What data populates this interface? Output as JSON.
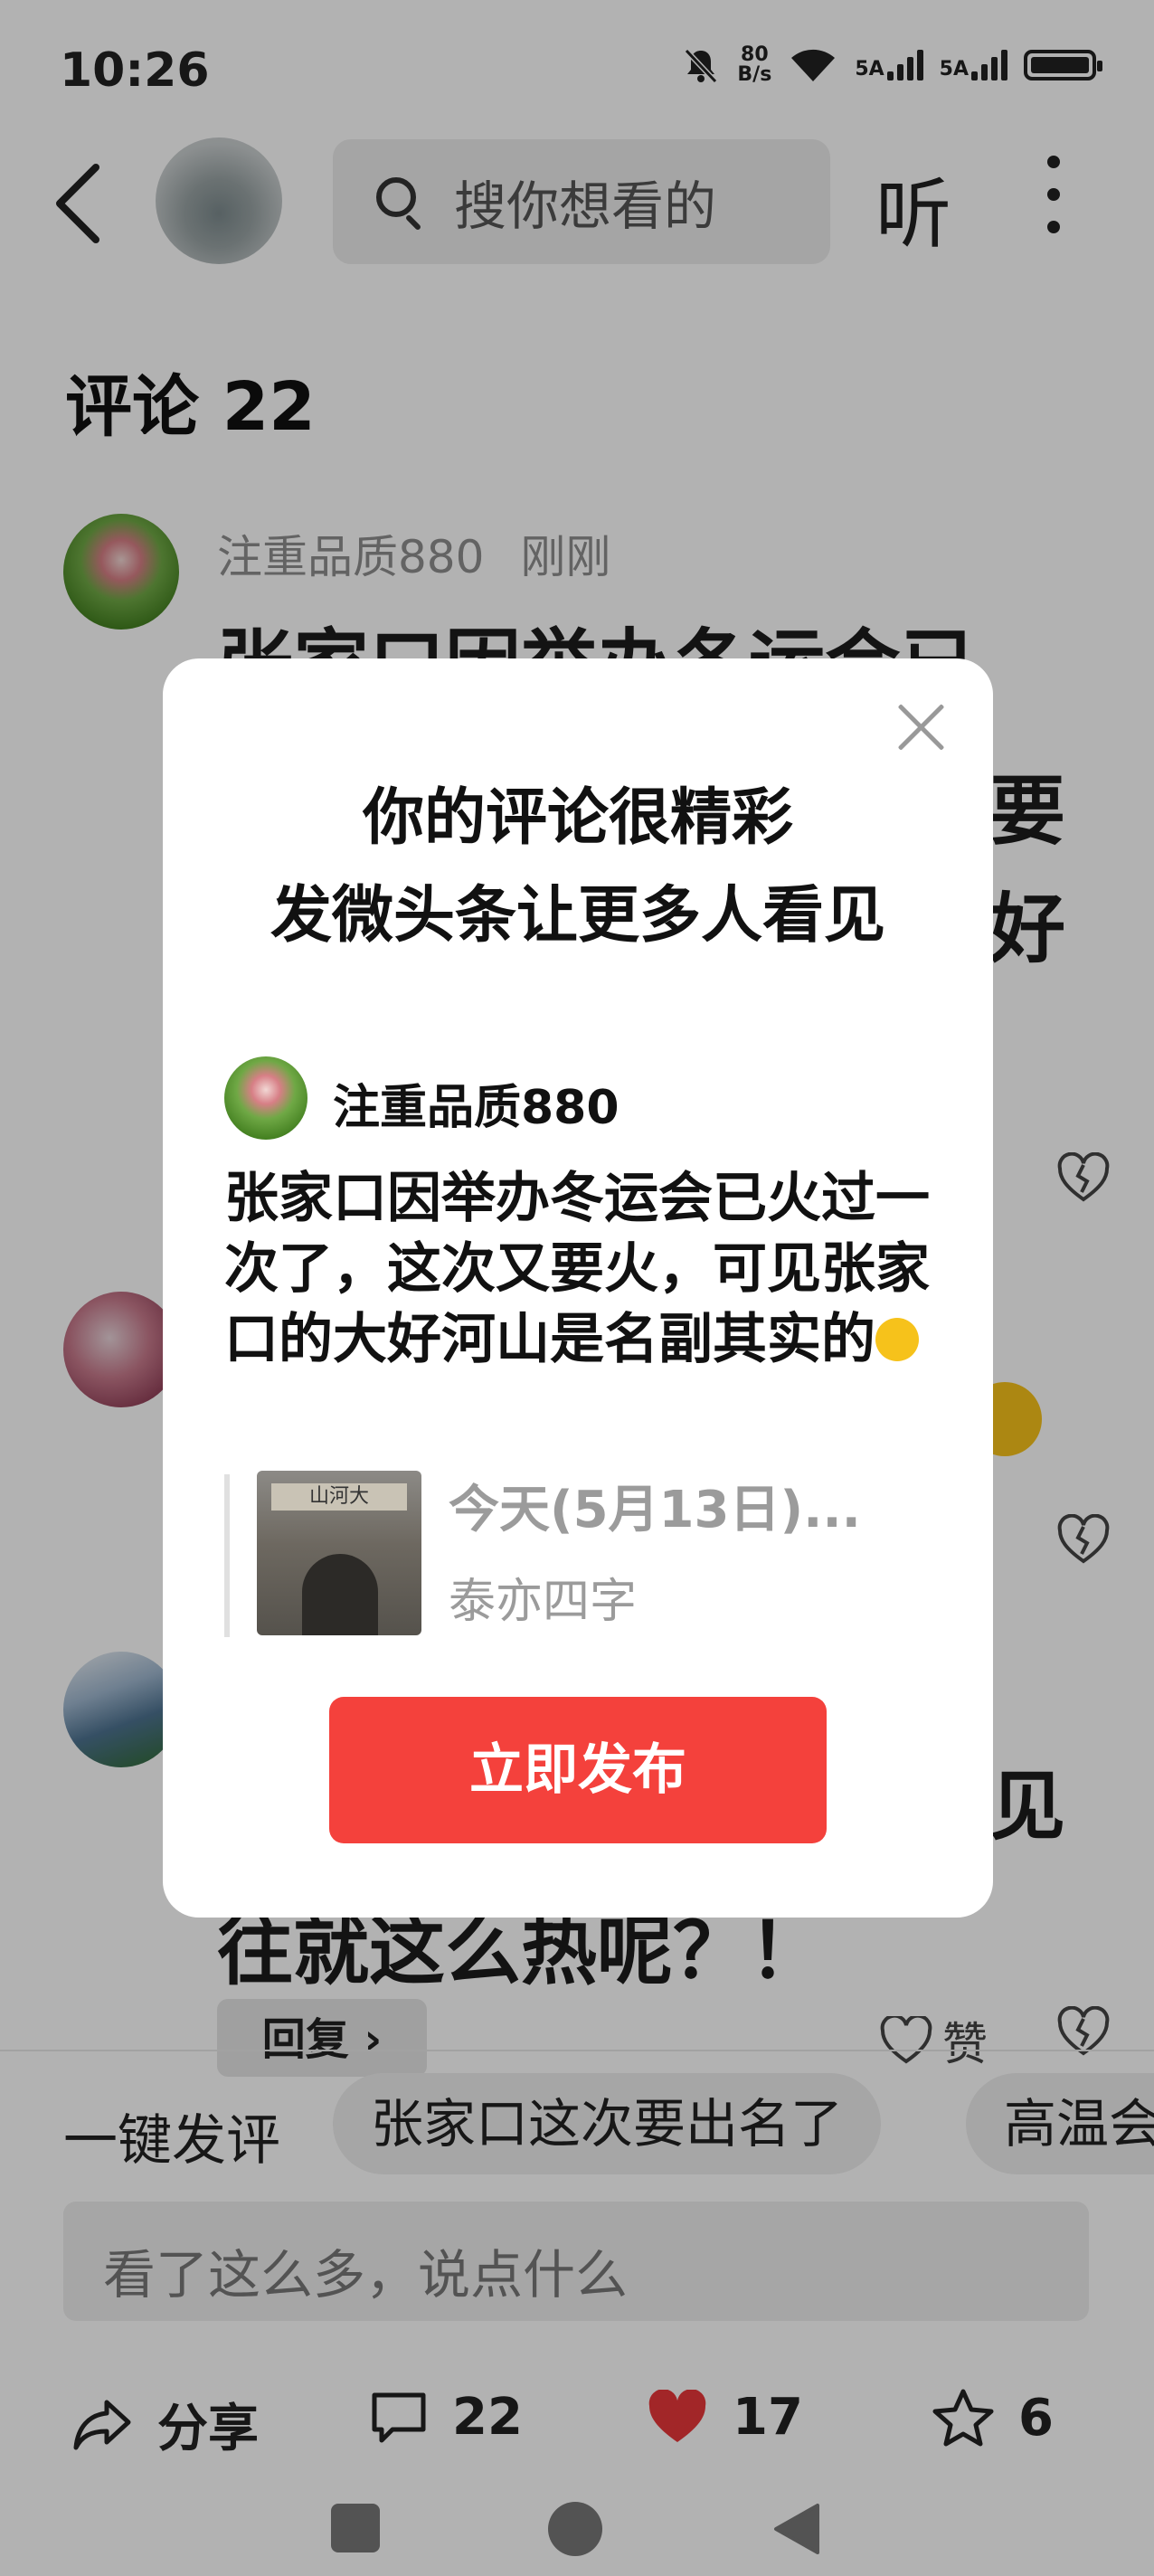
{
  "status_bar": {
    "time": "10:26",
    "net_speed_value": "80",
    "net_speed_unit": "B/s",
    "signal1_label": "5A",
    "signal2_label": "5A"
  },
  "top_bar": {
    "search_placeholder": "搜你想看的",
    "listen_label": "听"
  },
  "comments": {
    "title": "评论 22",
    "items": [
      {
        "user": "注重品质880",
        "time": "刚刚",
        "text_lines_visible": [
          "张家口因举办冬运会已",
          "要",
          "好"
        ]
      },
      {
        "text_lines_visible": [
          "见",
          "往就这么热呢？！"
        ],
        "reply_label": "回复 ›",
        "like_label": "赞"
      }
    ]
  },
  "bottom": {
    "quick_comment_label": "一键发评",
    "chips": [
      "张家口这次要出名了",
      "高温会"
    ],
    "input_placeholder": "看了这么多，说点什么",
    "share_label": "分享",
    "comment_count": "22",
    "like_count": "17",
    "favorite_count": "6"
  },
  "modal": {
    "title_line1": "你的评论很精彩",
    "title_line2": "发微头条让更多人看见",
    "user": "注重品质880",
    "comment_text": "张家口因举办冬运会已火过一次了，这次又要火，可见张家口的大好河山是名副其实的",
    "link_title": "今天(5月13日)...",
    "link_source": "泰亦四字",
    "thumb_sign": "山河大",
    "publish_label": "立即发布"
  },
  "colors": {
    "accent_red": "#f4413c",
    "like_red": "#e8373a"
  }
}
